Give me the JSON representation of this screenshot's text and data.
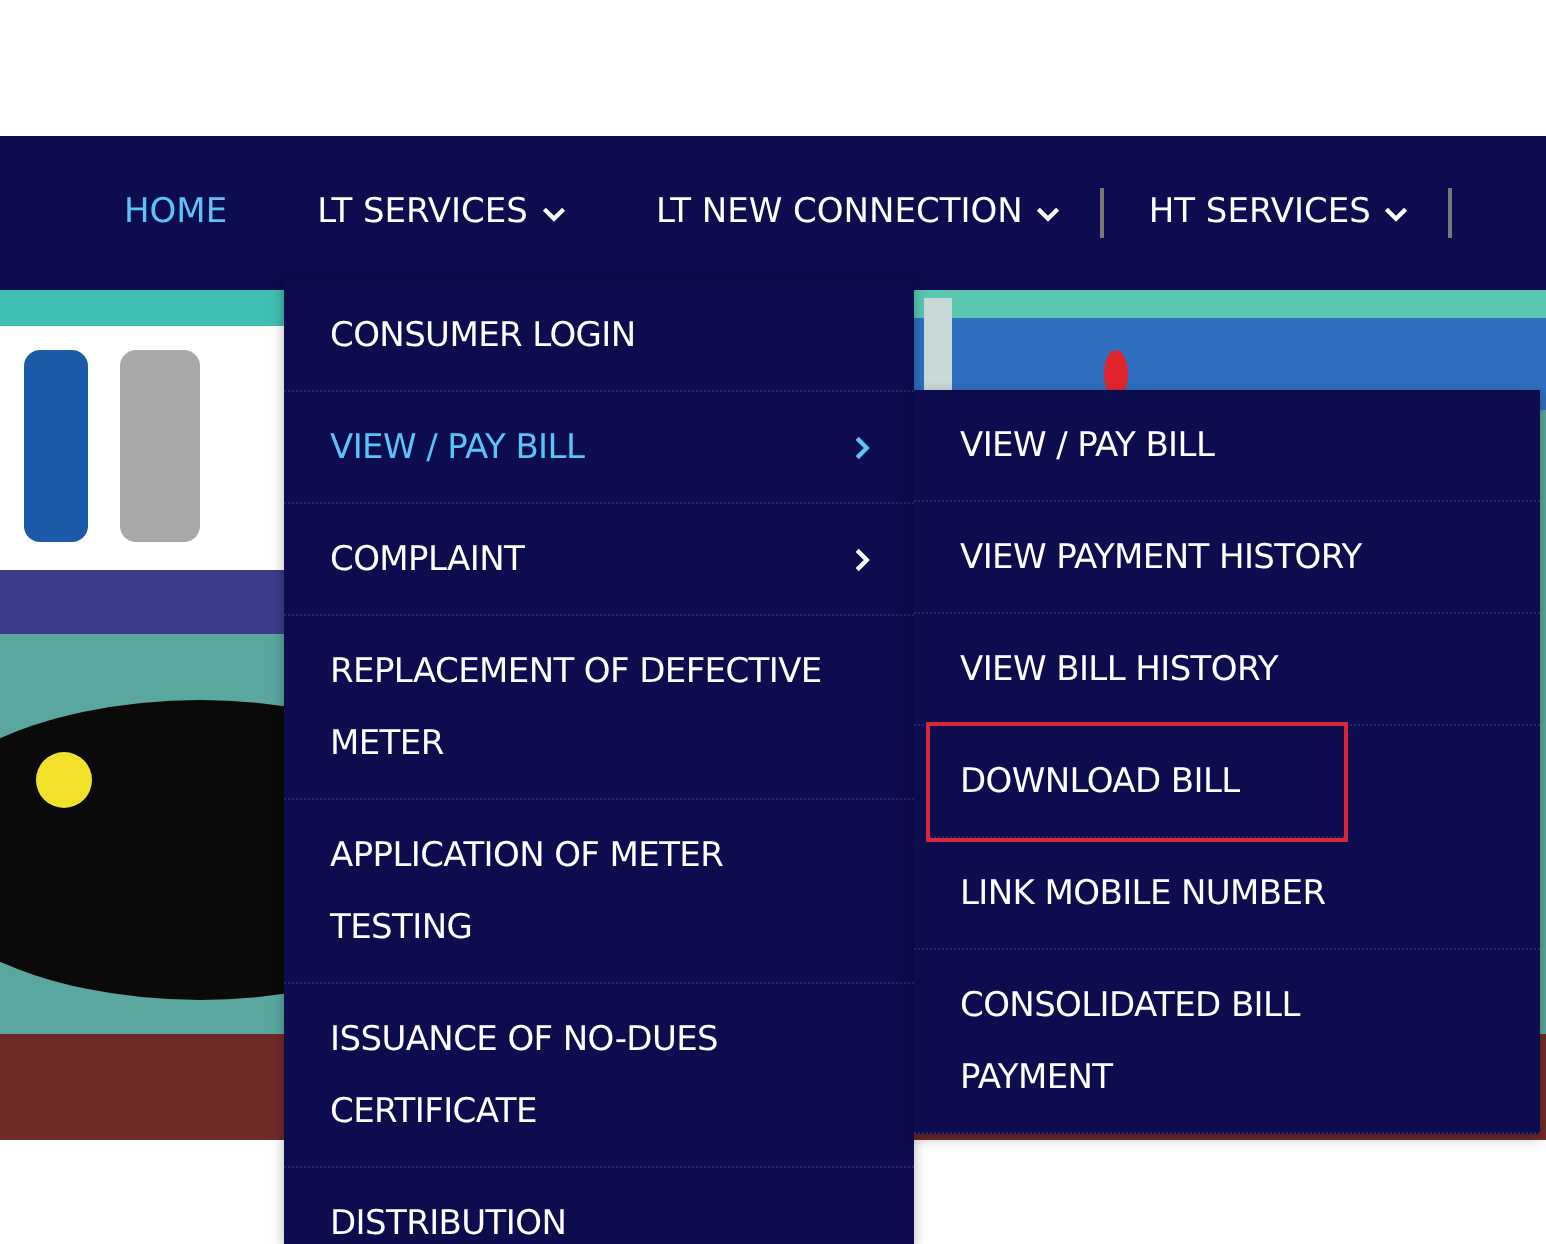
{
  "nav": [
    {
      "label": "HOME",
      "selected": true,
      "caret": false,
      "separator_after": false
    },
    {
      "label": "LT SERVICES",
      "selected": false,
      "caret": true,
      "separator_after": false
    },
    {
      "label": "LT NEW CONNECTION",
      "selected": false,
      "caret": true,
      "separator_after": true
    },
    {
      "label": "HT SERVICES",
      "selected": false,
      "caret": true,
      "separator_after": true
    }
  ],
  "dropdown": [
    {
      "label": "CONSUMER LOGIN",
      "selected": false,
      "submenu": false
    },
    {
      "label": "VIEW / PAY BILL",
      "selected": true,
      "submenu": true
    },
    {
      "label": "COMPLAINT",
      "selected": false,
      "submenu": true
    },
    {
      "label": "REPLACEMENT OF DEFECTIVE METER",
      "selected": false,
      "submenu": false
    },
    {
      "label": "APPLICATION OF METER TESTING",
      "selected": false,
      "submenu": false
    },
    {
      "label": "ISSUANCE OF NO-DUES CERTIFICATE",
      "selected": false,
      "submenu": false
    },
    {
      "label": "DISTRIBUTION",
      "selected": false,
      "submenu": false
    }
  ],
  "submenu": [
    {
      "label": "VIEW / PAY BILL",
      "highlighted": false
    },
    {
      "label": "VIEW PAYMENT HISTORY",
      "highlighted": false
    },
    {
      "label": "VIEW BILL HISTORY",
      "highlighted": false
    },
    {
      "label": "DOWNLOAD BILL",
      "highlighted": true
    },
    {
      "label": "LINK MOBILE NUMBER",
      "highlighted": false
    },
    {
      "label": "CONSOLIDATED BILL PAYMENT",
      "highlighted": false
    }
  ]
}
